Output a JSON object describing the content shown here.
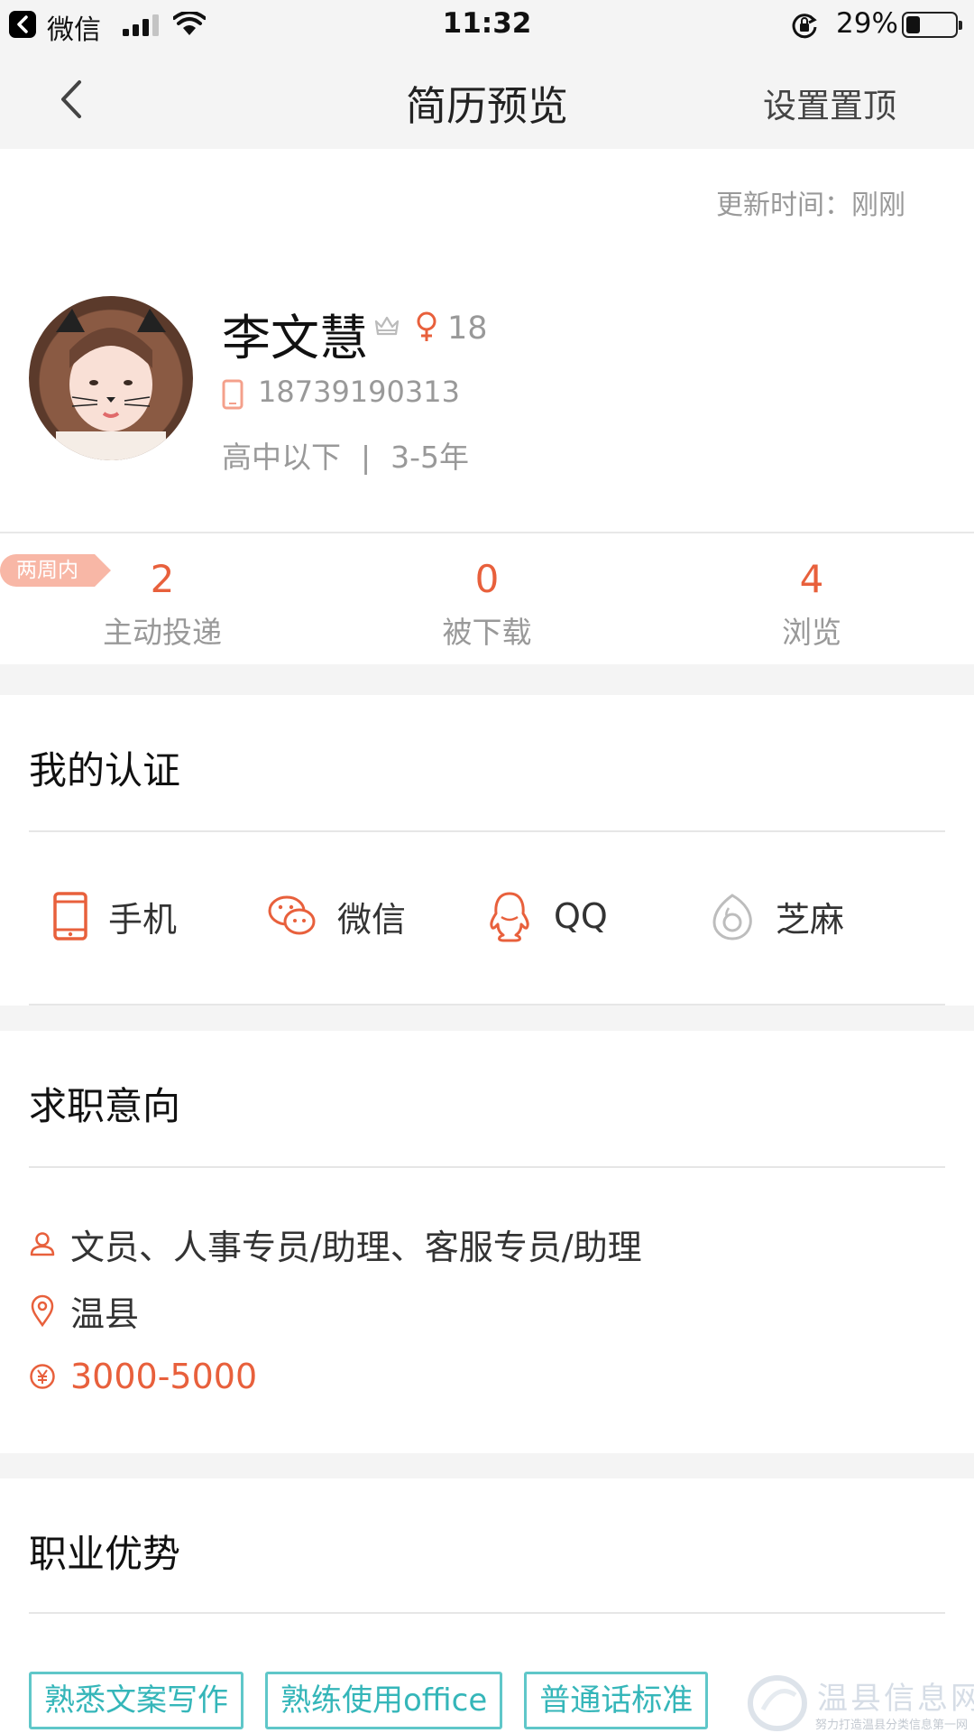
{
  "status_bar": {
    "app_name": "微信",
    "time": "11:32",
    "battery_percent": "29%",
    "battery_level": 0.29
  },
  "nav": {
    "back_icon": "chevron-left-icon",
    "title": "简历预览",
    "action": "设置置顶"
  },
  "update_time": "更新时间：刚刚",
  "profile": {
    "name": "李文慧",
    "age": "18",
    "phone": "18739190313",
    "education": "高中以下",
    "separator": "|",
    "experience": "3-5年"
  },
  "stats": {
    "tag": "两周内",
    "items": [
      {
        "value": "2",
        "label": "主动投递"
      },
      {
        "value": "0",
        "label": "被下载"
      },
      {
        "value": "4",
        "label": "浏览"
      }
    ]
  },
  "certification": {
    "title": "我的认证",
    "items": [
      {
        "label": "手机",
        "icon": "mobile-phone-icon"
      },
      {
        "label": "微信",
        "icon": "wechat-icon"
      },
      {
        "label": "QQ",
        "icon": "qq-penguin-icon"
      },
      {
        "label": "芝麻",
        "icon": "sesame-icon"
      }
    ]
  },
  "intention": {
    "title": "求职意向",
    "positions": "文员、人事专员/助理、客服专员/助理",
    "location": "温县",
    "salary": "3000-5000"
  },
  "advantages": {
    "title": "职业优势",
    "skills": [
      "熟悉文案写作",
      "熟练使用office",
      "普通话标准"
    ]
  },
  "watermark": {
    "title": "温县信息网",
    "subtitle": "努力打造温县分类信息第一网"
  },
  "colors": {
    "accent": "#e8603c",
    "teal": "#35b6b9",
    "gray_bg": "#f4f4f4",
    "muted_text": "#999999"
  }
}
